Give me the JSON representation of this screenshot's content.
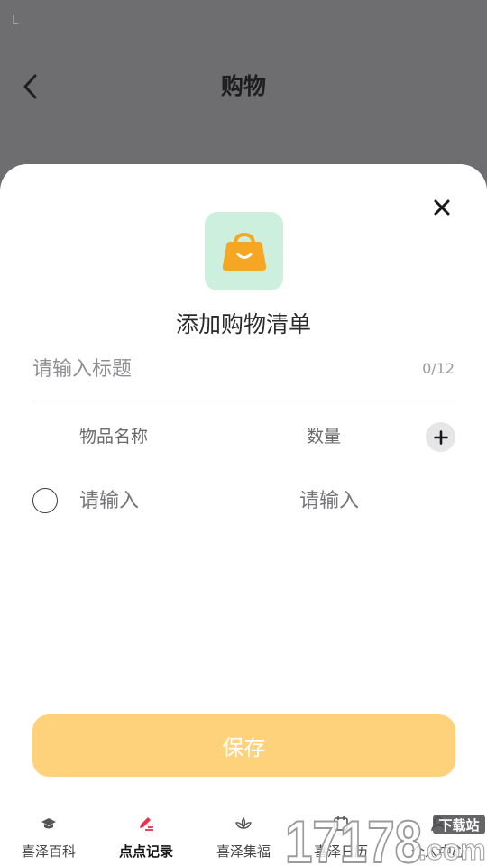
{
  "status_bar": {
    "mark": "L"
  },
  "header": {
    "title": "购物"
  },
  "sheet": {
    "title": "添加购物清单",
    "title_input": {
      "placeholder": "请输入标题",
      "value": "",
      "count": "0/12"
    },
    "columns": {
      "name": "物品名称",
      "quantity": "数量"
    },
    "items": [
      {
        "name_placeholder": "请输入",
        "quantity_placeholder": "请输入",
        "checked": false
      }
    ],
    "save_label": "保存",
    "accent_color": "#fed27b",
    "icon_bg_color": "#cdefdd",
    "icon_color": "#f5a623"
  },
  "tabbar": {
    "tabs": [
      {
        "label": "喜泽百科",
        "icon": "graduation-cap-icon",
        "active": false
      },
      {
        "label": "点点记录",
        "icon": "pen-icon",
        "active": true
      },
      {
        "label": "喜泽集福",
        "icon": "lotus-icon",
        "active": false
      },
      {
        "label": "喜泽日历",
        "icon": "calendar-icon",
        "active": false
      },
      {
        "label": "个人中心",
        "icon": "user-icon",
        "active": false
      }
    ],
    "active_color": "#e8344f"
  },
  "watermark": {
    "text": "17178",
    "suffix": ".com",
    "badge": "下载站"
  }
}
